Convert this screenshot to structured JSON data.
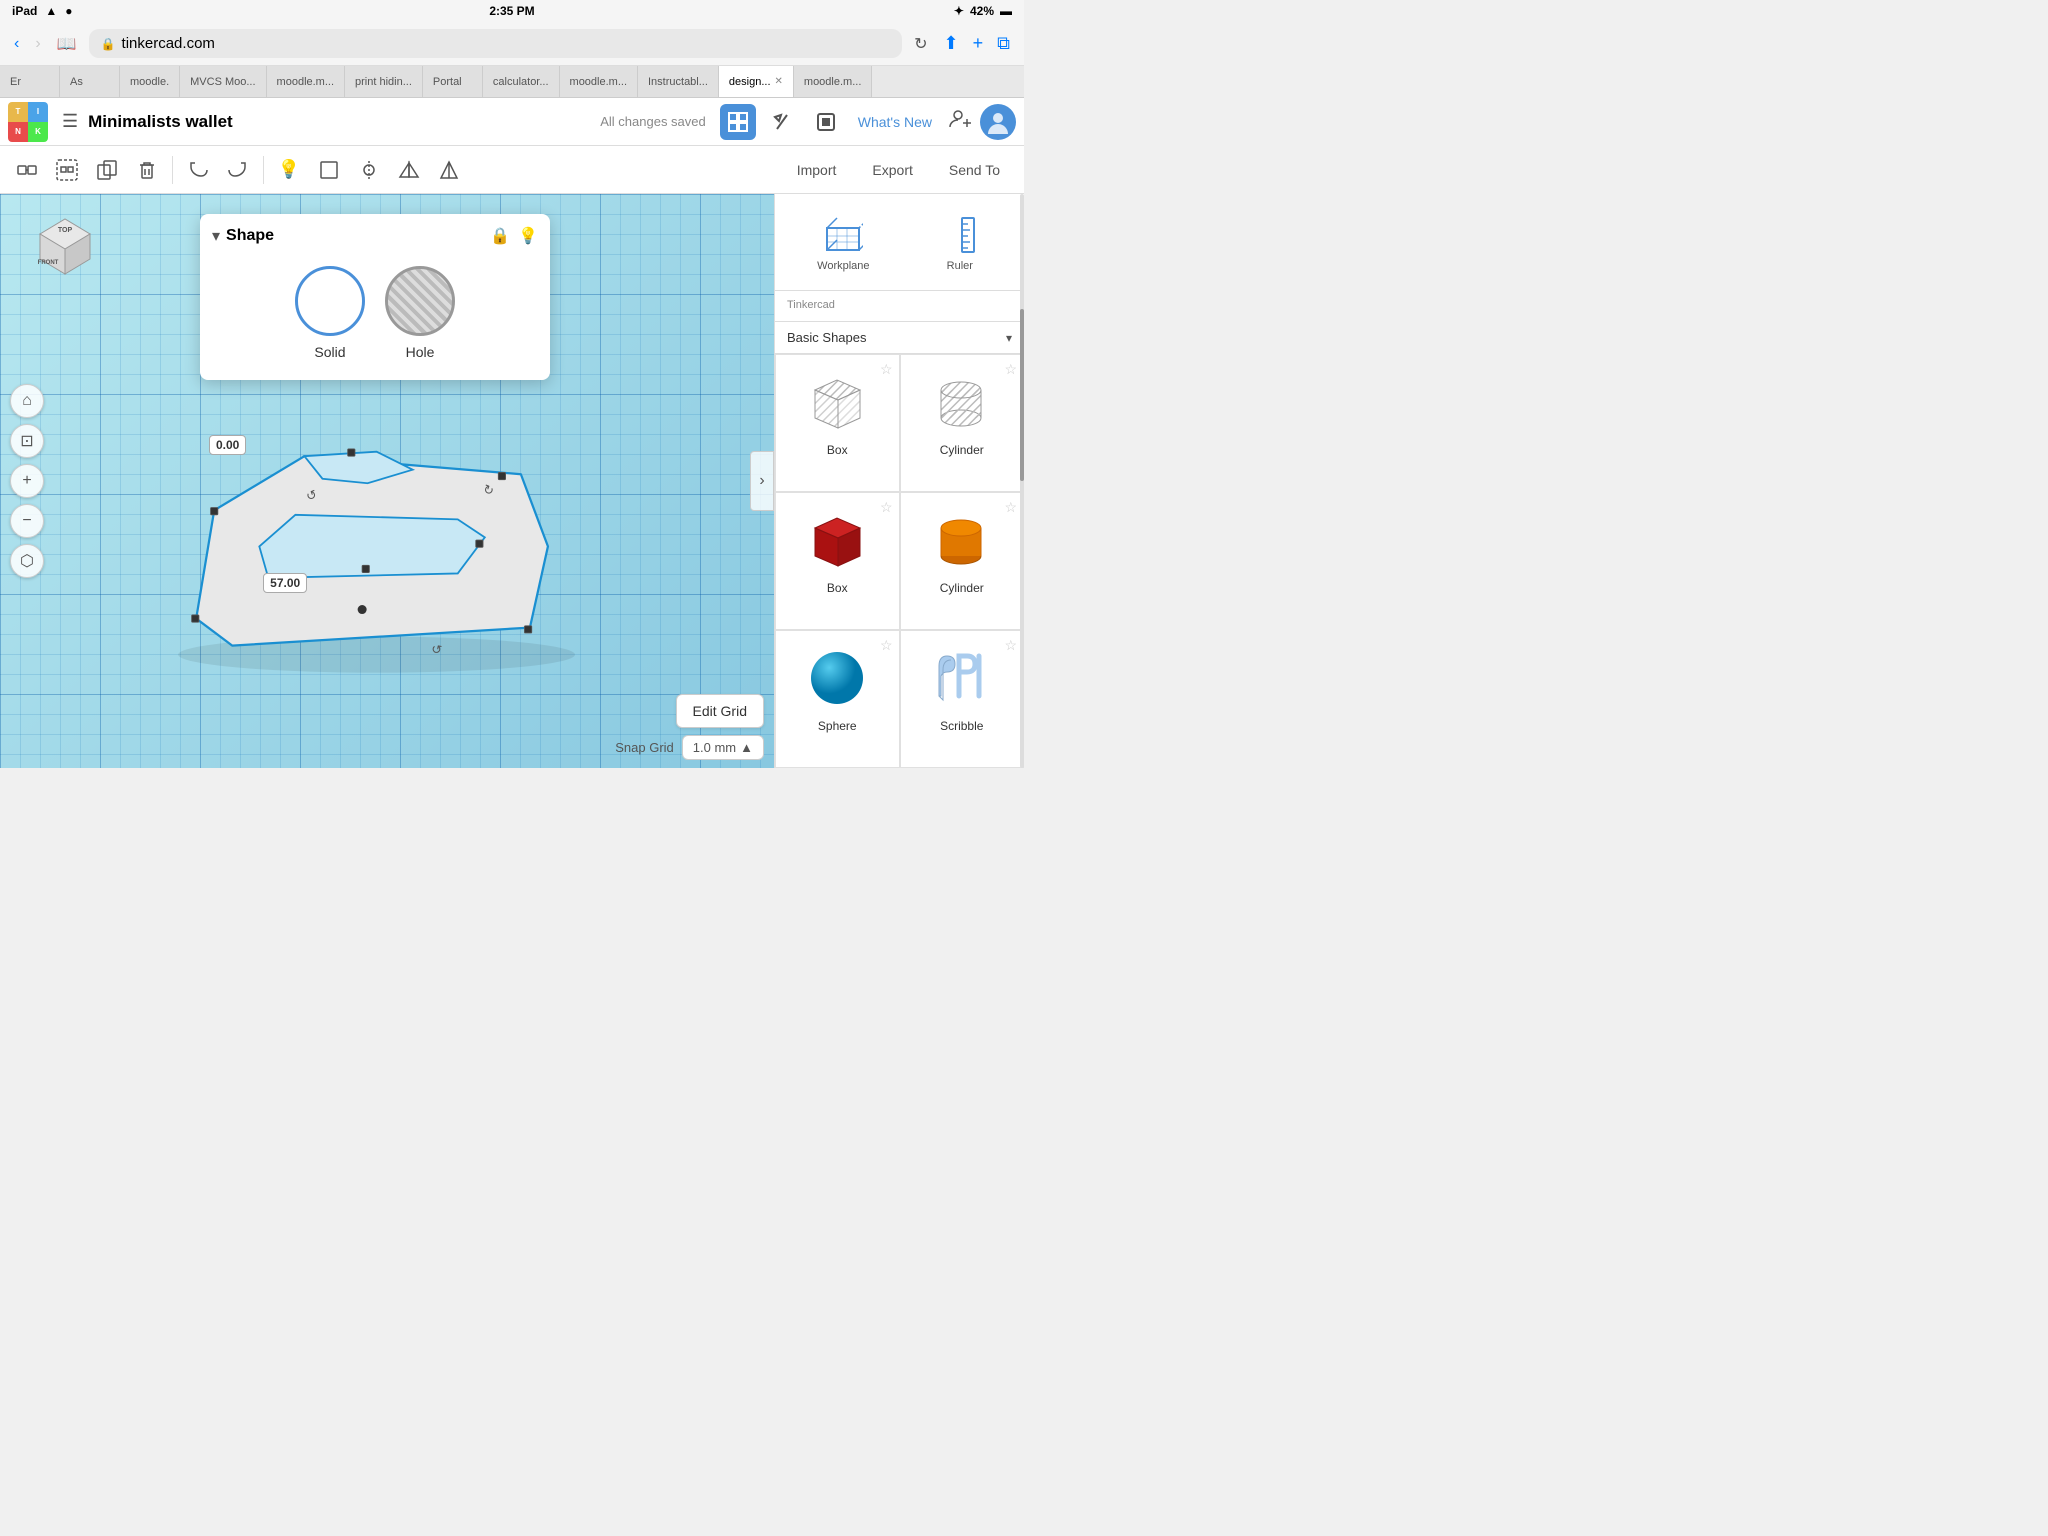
{
  "status_bar": {
    "left": [
      "iPad",
      "wifi",
      "signal"
    ],
    "time": "2:35 PM",
    "right": [
      "bluetooth",
      "42%"
    ]
  },
  "browser": {
    "back_label": "‹",
    "forward_label": "›",
    "bookmarks_label": "📖",
    "address": "tinkercad.com",
    "lock": "🔒",
    "reload": "↻",
    "share": "⬆",
    "new_tab": "+",
    "tabs": "⧉"
  },
  "tabs": [
    {
      "label": "Er",
      "active": false
    },
    {
      "label": "As",
      "active": false
    },
    {
      "label": "moodle.",
      "active": false
    },
    {
      "label": "MVCS Moo...",
      "active": false
    },
    {
      "label": "moodle.m...",
      "active": false
    },
    {
      "label": "print hidin...",
      "active": false
    },
    {
      "label": "Portal",
      "active": false
    },
    {
      "label": "calculator...",
      "active": false
    },
    {
      "label": "moodle.m...",
      "active": false
    },
    {
      "label": "Instructabl...",
      "active": false
    },
    {
      "label": "design...",
      "active": true,
      "closable": true
    },
    {
      "label": "moodle.m...",
      "active": false
    }
  ],
  "app_toolbar": {
    "logo": {
      "t": "T",
      "i": "I",
      "n": "N",
      "k": "K"
    },
    "menu_icon": "☰",
    "project_title": "Minimalists wallet",
    "save_status": "All changes saved",
    "view_3d": "⊞",
    "view_pickaxe": "⛏",
    "view_sim": "▪",
    "whats_new": "What's New",
    "add_user": "person+",
    "avatar": "👤"
  },
  "edit_toolbar": {
    "group": "⊡",
    "ungroup": "⊟",
    "duplicate": "⧉",
    "delete": "🗑",
    "undo": "↩",
    "redo": "↪",
    "bulb": "💡",
    "align": "⬜",
    "mirror": "⬤",
    "flip": "◫",
    "sym": "△▽",
    "import": "Import",
    "export": "Export",
    "send_to": "Send To"
  },
  "shape_panel": {
    "title": "Shape",
    "collapse": "▾",
    "lock_icon": "🔒",
    "bulb_icon": "💡",
    "solid_label": "Solid",
    "hole_label": "Hole"
  },
  "canvas": {
    "measure_0": "0.00",
    "measure_57": "57.00",
    "edit_grid": "Edit Grid",
    "snap_grid_label": "Snap Grid",
    "snap_value": "1.0 mm",
    "chevron": "›",
    "cube_top": "TOP",
    "cube_front": "FRONT"
  },
  "right_panel": {
    "workplane_label": "Workplane",
    "ruler_label": "Ruler",
    "category_label": "Basic Shapes",
    "dropdown": "▾",
    "tinkercad_label": "Tinkercad",
    "shapes": [
      {
        "name": "Box",
        "type": "box-grey",
        "starred": false
      },
      {
        "name": "Cylinder",
        "type": "cylinder-grey",
        "starred": false
      },
      {
        "name": "Box",
        "type": "box-red",
        "starred": false
      },
      {
        "name": "Cylinder",
        "type": "cylinder-orange",
        "starred": false
      },
      {
        "name": "Sphere",
        "type": "sphere-blue",
        "starred": false
      },
      {
        "name": "Scribble",
        "type": "scribble",
        "starred": false
      }
    ]
  }
}
